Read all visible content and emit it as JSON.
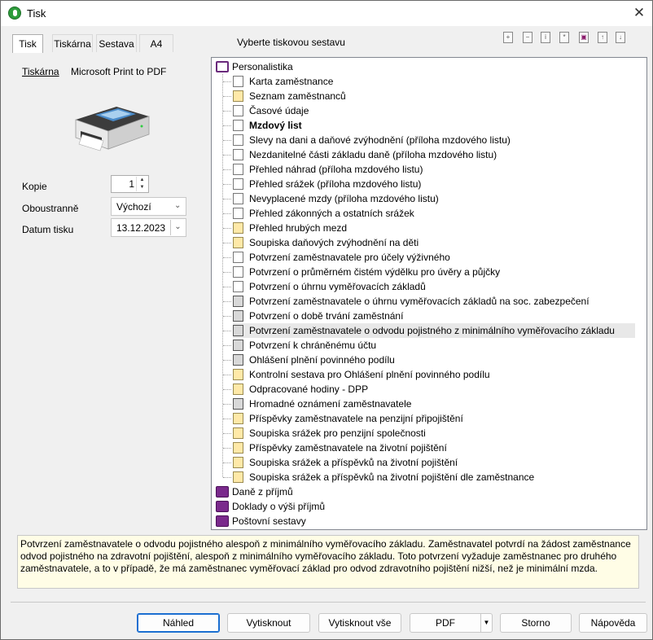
{
  "window": {
    "title": "Tisk",
    "close_glyph": "✕"
  },
  "tabs": [
    {
      "label": "Tisk",
      "active": true
    },
    {
      "label": "Tiskárna"
    },
    {
      "label": "Sestava"
    },
    {
      "label": "A4"
    }
  ],
  "printer": {
    "label": "Tiskárna",
    "name": "Microsoft Print to PDF"
  },
  "fields": {
    "copies": {
      "label": "Kopie",
      "value": "1"
    },
    "duplex": {
      "label": "Oboustranně",
      "value": "Výchozí"
    },
    "date": {
      "label": "Datum tisku",
      "value": "13.12.2023"
    }
  },
  "report_header": "Vyberte tiskovou sestavu",
  "toolbar_icons": [
    "expand-icon",
    "collapse-icon",
    "info-icon",
    "asterisk-icon",
    "copy-report-icon",
    "move-up-icon",
    "move-down-icon"
  ],
  "tree": {
    "root": {
      "label": "Personalistika",
      "icon": "open-book-icon"
    },
    "children": [
      {
        "label": "Karta zaměstnance",
        "icon": "document-icon"
      },
      {
        "label": "Seznam zaměstnanců",
        "icon": "yellow-document-icon"
      },
      {
        "label": "Časové údaje",
        "icon": "document-icon"
      },
      {
        "label": "Mzdový list",
        "icon": "document-icon",
        "bold": true
      },
      {
        "label": "Slevy na dani a daňové zvýhodnění (příloha mzdového listu)",
        "icon": "document-icon"
      },
      {
        "label": "Nezdanitelné části základu daně (příloha mzdového listu)",
        "icon": "document-icon"
      },
      {
        "label": "Přehled náhrad (příloha mzdového listu)",
        "icon": "document-icon"
      },
      {
        "label": "Přehled srážek (příloha mzdového listu)",
        "icon": "document-icon"
      },
      {
        "label": "Nevyplacené mzdy (příloha mzdového listu)",
        "icon": "document-icon"
      },
      {
        "label": "Přehled zákonných a ostatních srážek",
        "icon": "document-icon"
      },
      {
        "label": "Přehled hrubých mezd",
        "icon": "yellow-document-icon"
      },
      {
        "label": "Soupiska daňových zvýhodnění na děti",
        "icon": "yellow-document-icon"
      },
      {
        "label": "Potvrzení zaměstnavatele pro účely výživného",
        "icon": "document-icon"
      },
      {
        "label": "Potvrzení o průměrném čistém výdělku pro úvěry a půjčky",
        "icon": "document-icon"
      },
      {
        "label": "Potvrzení o úhrnu vyměřovacích základů",
        "icon": "document-icon"
      },
      {
        "label": "Potvrzení zaměstnavatele o úhrnu vyměřovacích základů na soc. zabezpečení",
        "icon": "gray-document-icon"
      },
      {
        "label": "Potvrzení o době trvání zaměstnání",
        "icon": "gray-document-icon"
      },
      {
        "label": "Potvrzení zaměstnavatele o odvodu pojistného z minimálního vyměřovacího základu",
        "icon": "gray-document-icon",
        "selected": true
      },
      {
        "label": "Potvrzení k chráněnému účtu",
        "icon": "gray-document-icon"
      },
      {
        "label": "Ohlášení plnění povinného podílu",
        "icon": "gray-document-icon"
      },
      {
        "label": "Kontrolní sestava pro Ohlášení plnění povinného podílu",
        "icon": "yellow-document-icon"
      },
      {
        "label": "Odpracované hodiny - DPP",
        "icon": "yellow-document-icon"
      },
      {
        "label": "Hromadné oznámení zaměstnavatele",
        "icon": "gray-document-icon"
      },
      {
        "label": "Příspěvky zaměstnavatele na penzijní připojištění",
        "icon": "yellow-document-icon"
      },
      {
        "label": "Soupiska srážek pro penzijní společnosti",
        "icon": "yellow-document-icon"
      },
      {
        "label": "Příspěvky zaměstnavatele na životní pojištění",
        "icon": "yellow-document-icon"
      },
      {
        "label": "Soupiska srážek a příspěvků na životní pojištění",
        "icon": "yellow-document-icon"
      },
      {
        "label": "Soupiska srážek a příspěvků na životní pojištění dle zaměstnance",
        "icon": "yellow-document-icon"
      }
    ],
    "others": [
      {
        "label": "Daně z příjmů",
        "icon": "book-icon"
      },
      {
        "label": "Doklady o výši příjmů",
        "icon": "book-icon"
      },
      {
        "label": "Poštovní sestavy",
        "icon": "book-icon"
      }
    ]
  },
  "description": "Potvrzení zaměstnavatele o odvodu pojistného alespoň z minimálního vyměřovacího základu. Zaměstnavatel potvrdí na žádost zaměstnance odvod pojistného na zdravotní pojištění, alespoň z minimálního vyměřovacího základu. Toto potvrzení vyžaduje zaměstnanec pro druhého zaměstnavatele, a to v případě, že má zaměstnanec vyměřovací základ pro odvod zdravotního pojištění nižší, než je minimální mzda.",
  "buttons": {
    "preview": "Náhled",
    "print": "Vytisknout",
    "print_all": "Vytisknout vše",
    "pdf": "PDF",
    "cancel": "Storno",
    "help": "Nápověda"
  },
  "colors": {
    "accent": "#1b6fd1",
    "description_bg": "#fffde6",
    "book": "#7a2a8c"
  }
}
